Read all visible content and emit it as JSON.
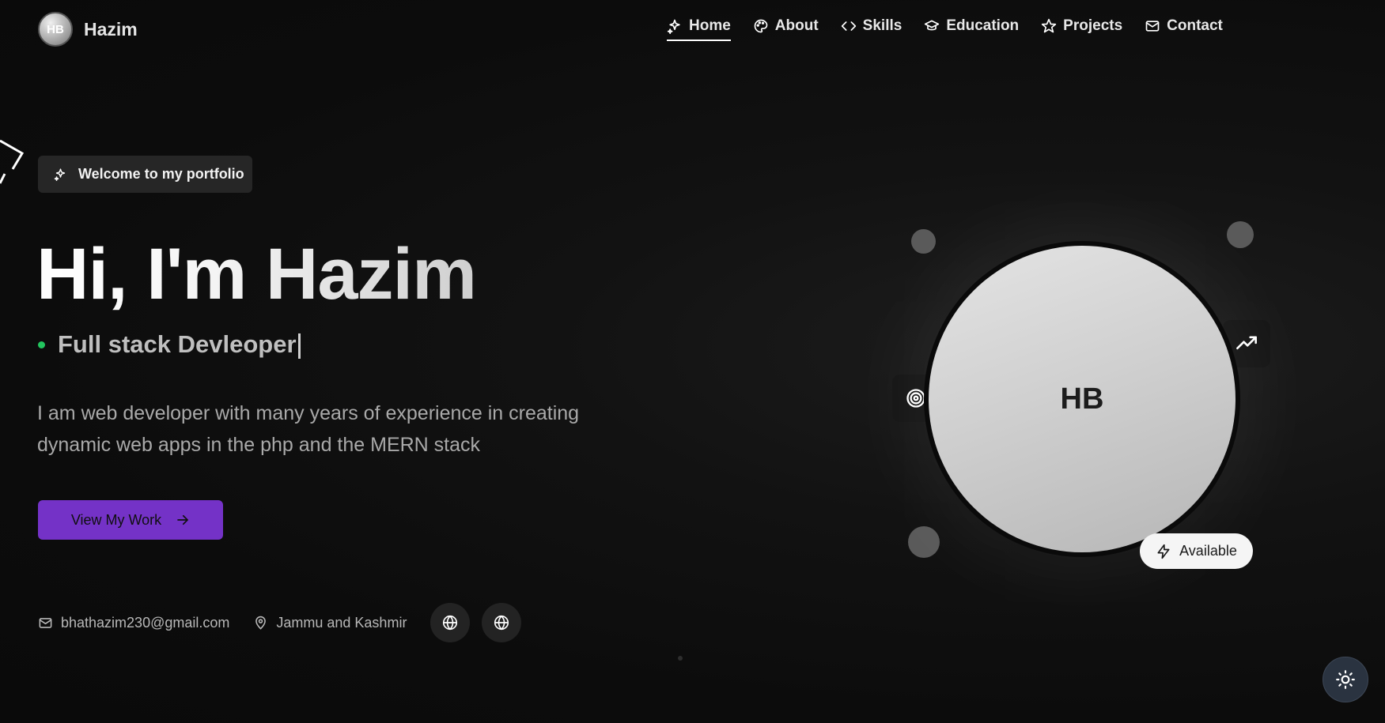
{
  "brand": {
    "logo_text": "HB",
    "name": "Hazim"
  },
  "nav": {
    "items": [
      {
        "label": "Home",
        "icon": "sparkles-icon",
        "active": true
      },
      {
        "label": "About",
        "icon": "palette-icon"
      },
      {
        "label": "Skills",
        "icon": "code-icon"
      },
      {
        "label": "Education",
        "icon": "graduation-cap-icon"
      },
      {
        "label": "Projects",
        "icon": "star-icon"
      },
      {
        "label": "Contact",
        "icon": "mail-icon"
      }
    ]
  },
  "hero": {
    "welcome_label": "Welcome to my portfolio",
    "title": "Hi, I'm Hazim",
    "role": "Full stack Devleoper",
    "description": "I am web developer with many years of experience in creating dynamic web apps in the php and the MERN stack",
    "cta_label": "View My Work"
  },
  "contact": {
    "email": "bhathazim230@gmail.com",
    "location": "Jammu and Kashmir",
    "social_icons": [
      "globe-icon",
      "globe-icon"
    ]
  },
  "profile": {
    "initials": "HB",
    "status_badge": "Available"
  },
  "colors": {
    "accent": "#7432c7",
    "status_dot": "#22c55e",
    "background": "#0c0c0c"
  }
}
